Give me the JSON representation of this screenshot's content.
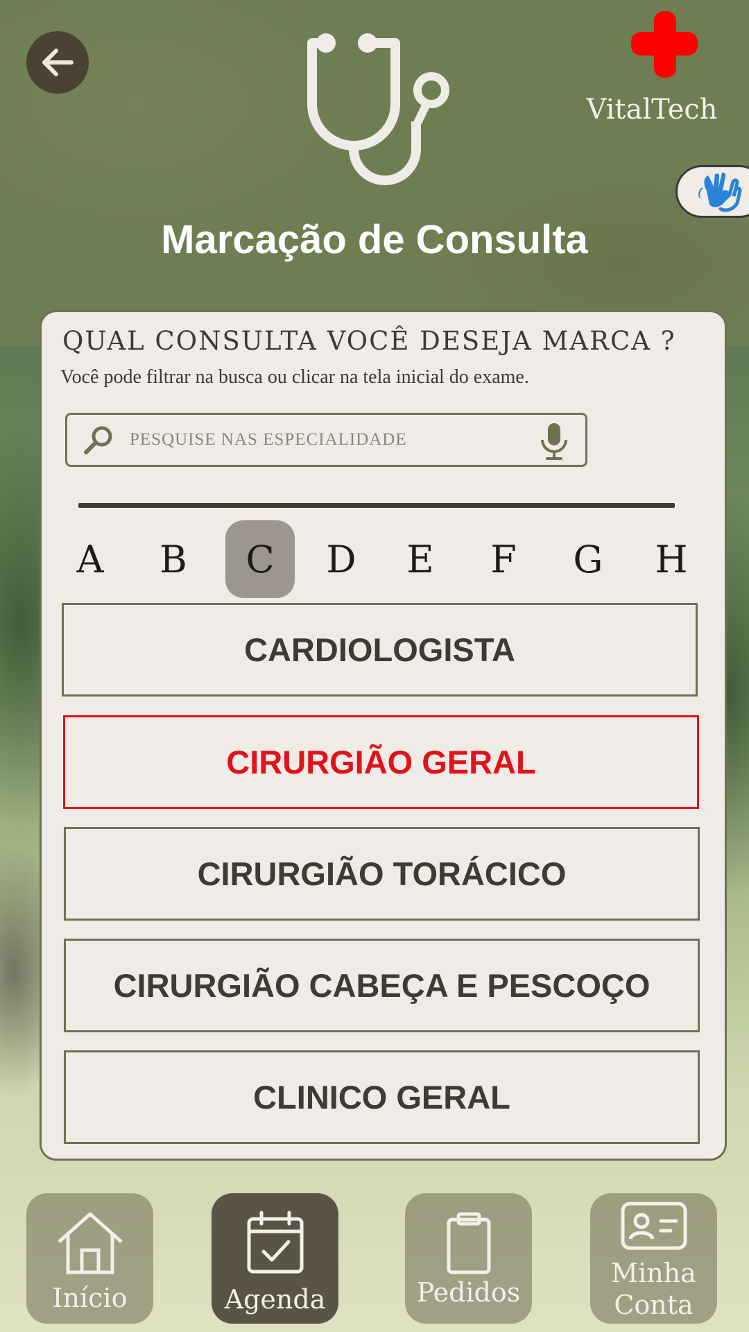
{
  "header": {
    "title": "Marcação de Consulta",
    "brand": "VitalTech",
    "icons": [
      "back-arrow-icon",
      "stethoscope-icon",
      "medical-cross-icon",
      "sign-language-icon"
    ],
    "brand_color": "#ff0000"
  },
  "card": {
    "question": "QUAL CONSULTA VOCÊ DESEJA MARCA ?",
    "hint": "Você pode filtrar na busca ou clicar na tela inicial do exame.",
    "search": {
      "placeholder": "PESQUISE NAS ESPECIALIDADE",
      "value": ""
    },
    "letters": [
      "A",
      "B",
      "C",
      "D",
      "E",
      "F",
      "G",
      "H"
    ],
    "active_letter": "C",
    "specialties": [
      "CARDIOLOGISTA",
      "CIRURGIÃO GERAL",
      "CIRURGIÃO TORÁCICO",
      "CIRURGIÃO CABEÇA E PESCOÇO",
      "CLINICO GERAL"
    ],
    "selected_specialty": "CIRURGIÃO GERAL",
    "selected_color": "#e0121a"
  },
  "nav": {
    "items": [
      {
        "label": "Início",
        "icon": "home-icon"
      },
      {
        "label": "Agenda",
        "icon": "calendar-check-icon"
      },
      {
        "label": "Pedidos",
        "icon": "clipboard-icon"
      },
      {
        "label_line1": "Minha",
        "label_line2": "Conta",
        "icon": "id-card-icon"
      }
    ],
    "active": "Agenda"
  }
}
